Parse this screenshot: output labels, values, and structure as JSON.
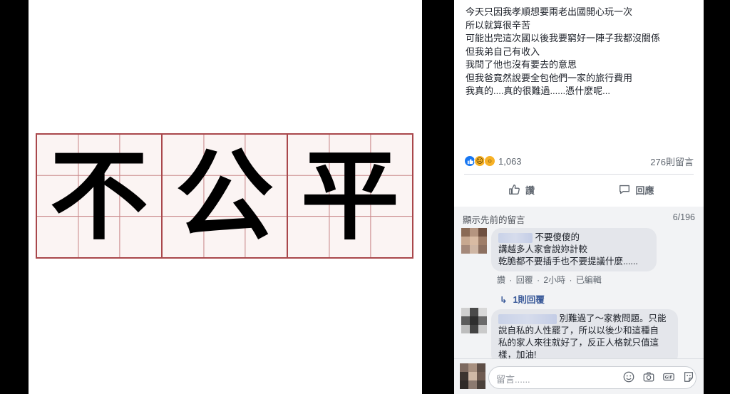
{
  "photo": {
    "characters": [
      "不",
      "公",
      "平"
    ],
    "grid_color": "#a9474b"
  },
  "post": {
    "lines": [
      "今天只因我孝順想要兩老出國開心玩一次",
      "所以就算很辛苦",
      "可能出完這次國以後我要窮好一陣子我都沒關係",
      "但我弟自己有收入",
      "我問了他也沒有要去的意思",
      "但我爸竟然說要全包他們一家的旅行費用",
      "我真的....真的很難過......憑什麼呢..."
    ],
    "reactions": {
      "icons": [
        "like-icon",
        "sad-icon",
        "wow-icon"
      ],
      "count": "1,063"
    },
    "comment_count": "276則留言",
    "actions": {
      "like_label": "讚",
      "comment_label": "回應"
    }
  },
  "comments_section": {
    "show_previous": "顯示先前的留言",
    "position": "6/196",
    "comments": [
      {
        "lines": [
          "不要傻傻的",
          "講越多人家會說妳計較",
          "乾脆都不要插手也不要提議什麼......"
        ],
        "meta": {
          "like": "讚",
          "reply": "回覆",
          "time": "2小時",
          "edited": "已編輯",
          "sep": "·"
        },
        "replies": "1則回覆"
      },
      {
        "lines": [
          "別難過了～家教問題。只能",
          "說自私的人性罷了，所以以後少和這種自",
          "私的家人來往就好了，反正人格就只值這",
          "樣，加油!"
        ]
      }
    ],
    "composer_placeholder": "留言......"
  }
}
